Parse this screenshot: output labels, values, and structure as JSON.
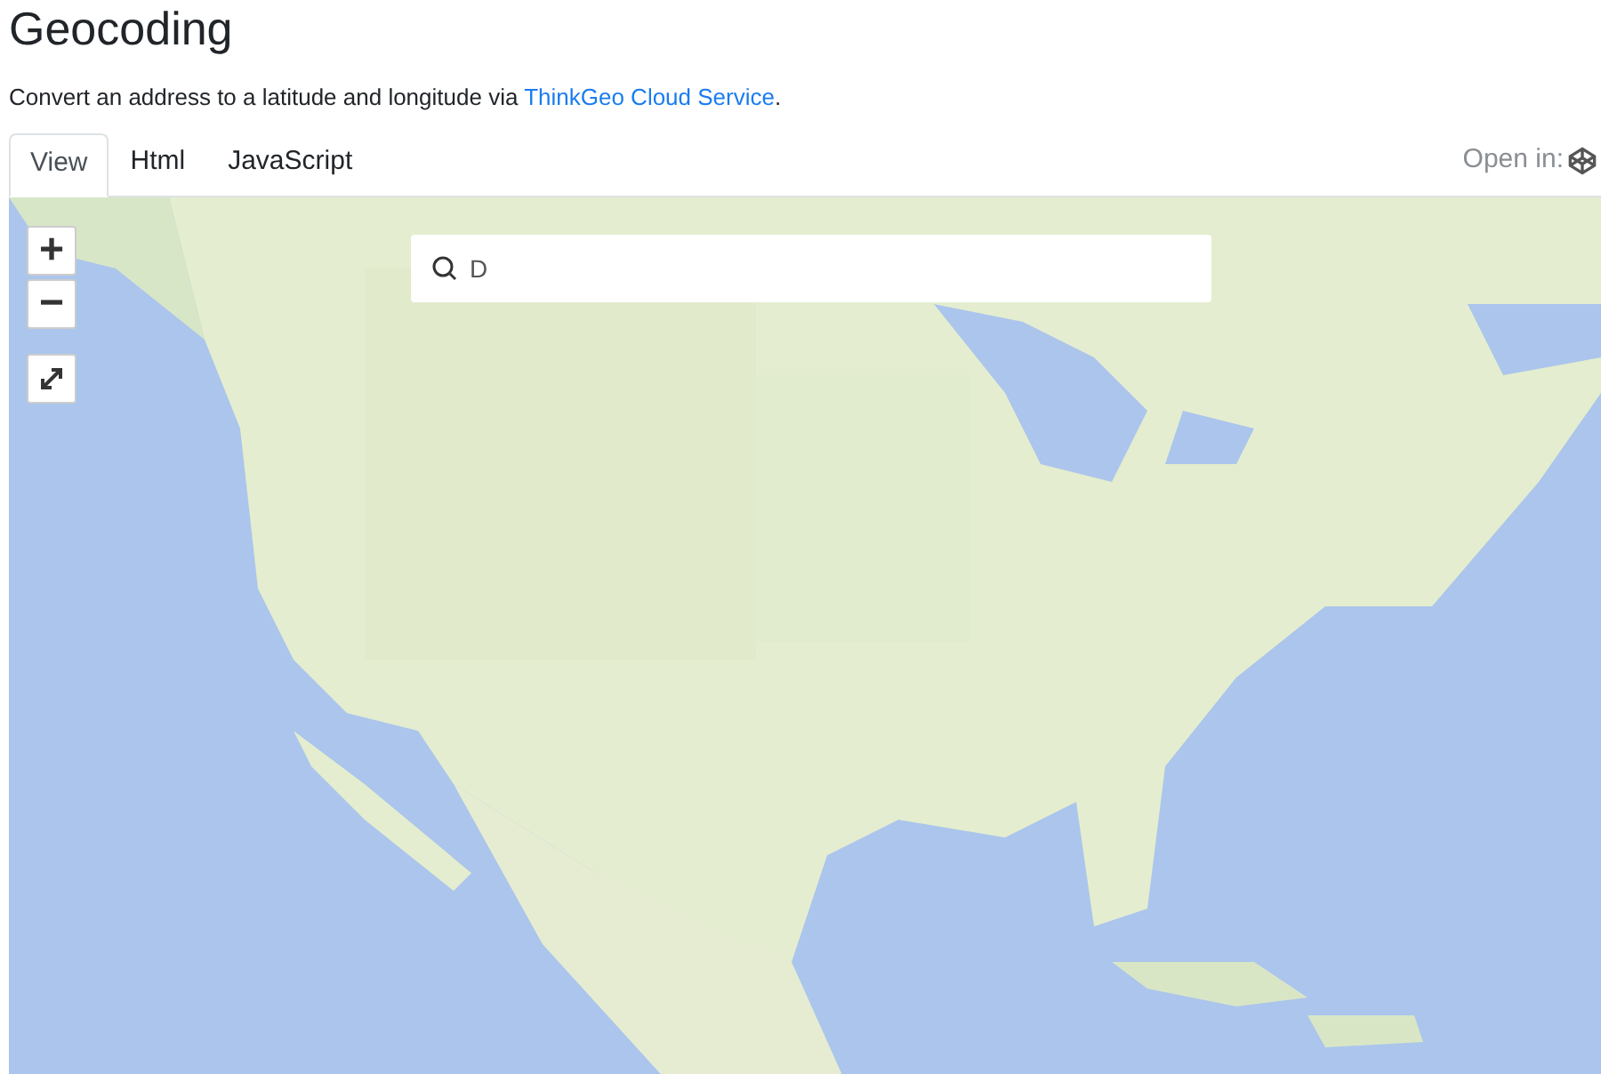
{
  "page": {
    "title": "Geocoding",
    "description": "Convert an address to a latitude and longitude via ",
    "description_link": "ThinkGeo Cloud Service",
    "description_end": "."
  },
  "tabs": [
    {
      "label": "View",
      "selected": true
    },
    {
      "label": "Html",
      "selected": false
    },
    {
      "label": "JavaScript",
      "selected": false
    }
  ],
  "open_in": {
    "label": "Open in:"
  },
  "map": {
    "zoom_in": "+",
    "zoom_out": "−",
    "search": {
      "value": "D"
    }
  }
}
